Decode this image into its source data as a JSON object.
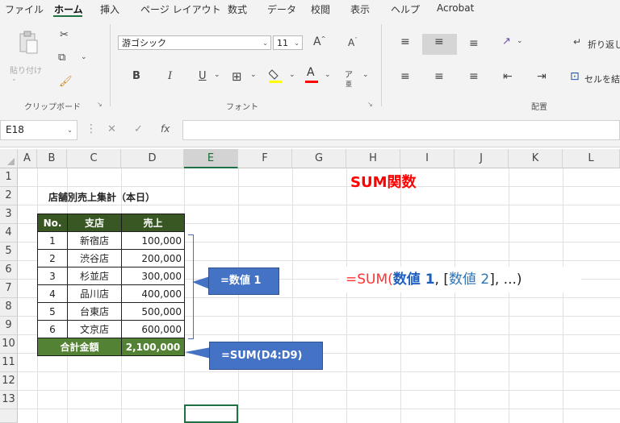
{
  "menu_tabs": [
    "ファイル",
    "ホーム",
    "挿入",
    "ページ レイアウト",
    "数式",
    "データ",
    "校閲",
    "表示",
    "ヘルプ",
    "Acrobat"
  ],
  "ribbon": {
    "clipboard": {
      "paste_label": "貼り付け",
      "group_label": "クリップボード"
    },
    "font": {
      "font_name": "游ゴシック",
      "font_size": "11",
      "bold": "B",
      "italic": "I",
      "underline": "U",
      "group_label": "フォント"
    },
    "alignment": {
      "wrap_text_label": "折り返し",
      "merge_label": "セルを結合",
      "group_label": "配置"
    }
  },
  "formula_bar": {
    "name_box": "E18",
    "fx": "fx",
    "value": ""
  },
  "columns": [
    "A",
    "B",
    "C",
    "D",
    "E",
    "F",
    "G",
    "H",
    "I",
    "J",
    "K",
    "L"
  ],
  "rows": [
    "1",
    "2",
    "3",
    "4",
    "5",
    "6",
    "7",
    "8",
    "9",
    "10",
    "11",
    "12",
    "13"
  ],
  "sheet": {
    "heading": "SUM関数",
    "table_title": "店舗別売上集計（本日）",
    "headers": [
      "No.",
      "支店",
      "売上"
    ],
    "rows": [
      {
        "no": "1",
        "branch": "新宿店",
        "sales": "100,000"
      },
      {
        "no": "2",
        "branch": "渋谷店",
        "sales": "200,000"
      },
      {
        "no": "3",
        "branch": "杉並店",
        "sales": "300,000"
      },
      {
        "no": "4",
        "branch": "品川店",
        "sales": "400,000"
      },
      {
        "no": "5",
        "branch": "台東店",
        "sales": "500,000"
      },
      {
        "no": "6",
        "branch": "文京店",
        "sales": "600,000"
      }
    ],
    "total_label": "合計金額",
    "total_value": "2,100,000",
    "callout_args": "=数値 1",
    "callout_formula": "=SUM(D4:D9)",
    "syntax": {
      "eq": "=",
      "func": "SUM",
      "open": "(",
      "arg1": "数値 1",
      "sep1": ", [",
      "arg2": "数値 2",
      "rest": "], ...)"
    }
  },
  "colors": {
    "header_green": "#385723",
    "total_green": "#548235",
    "callout_blue": "#4472c4",
    "heading_red": "#ff0000",
    "accent": "#1e7145"
  }
}
